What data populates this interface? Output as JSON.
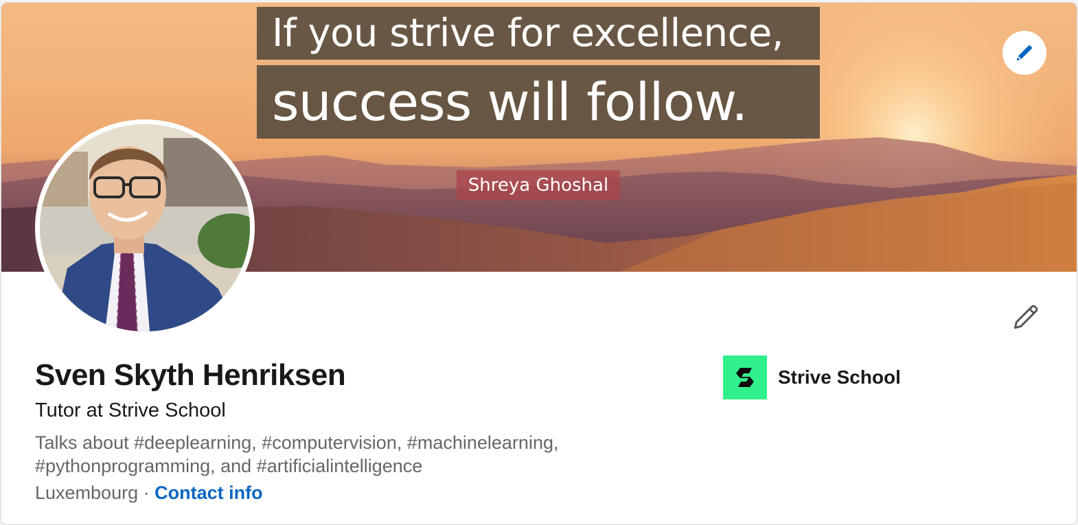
{
  "cover": {
    "quote_line1": "If you strive for excellence,",
    "quote_line2": "success will follow.",
    "quote_author": "Shreya Ghoshal",
    "edit_icon": "pencil-icon"
  },
  "profile": {
    "name": "Sven Skyth Henriksen",
    "headline": "Tutor at Strive School",
    "talks_about": "Talks about #deeplearning, #computervision, #machinelearning, #pythonprogramming, and #artificialintelligence",
    "location": "Luxembourg",
    "separator": " · ",
    "contact_label": "Contact info",
    "edit_icon": "pencil-icon"
  },
  "company": {
    "name": "Strive School",
    "logo_color": "#30f08b"
  },
  "colors": {
    "link": "#0a66c2",
    "text_primary": "#191919",
    "text_secondary": "#666666"
  }
}
